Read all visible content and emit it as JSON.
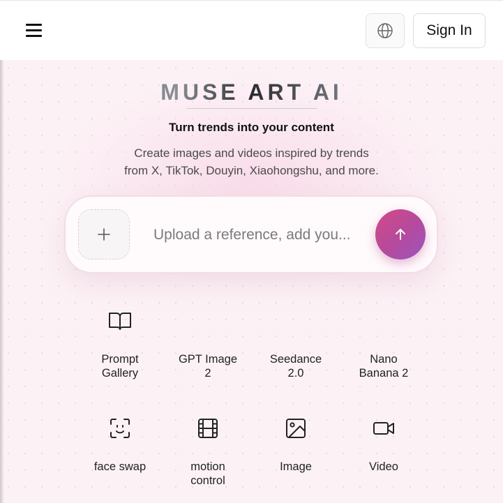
{
  "header": {
    "menu_icon": "hamburger-menu-icon",
    "language_icon": "globe-icon",
    "sign_in_label": "Sign In"
  },
  "hero": {
    "brand": "MUSE ART AI",
    "tagline": "Turn trends into your content",
    "description_line1": "Create images and videos inspired by trends",
    "description_line2": "from X, TikTok, Douyin, Xiaohongshu, and more."
  },
  "prompt": {
    "add_icon": "plus-icon",
    "placeholder": "Upload a reference, add you...",
    "send_icon": "arrow-up-icon",
    "send_color": "#c44a92"
  },
  "tools": [
    {
      "label_line1": "Prompt",
      "label_line2": "Gallery",
      "icon": "book-open-icon"
    },
    {
      "label_line1": "GPT Image",
      "label_line2": "2",
      "icon": ""
    },
    {
      "label_line1": "Seedance",
      "label_line2": "2.0",
      "icon": ""
    },
    {
      "label_line1": "Nano",
      "label_line2": "Banana 2",
      "icon": ""
    },
    {
      "label_line1": "face swap",
      "label_line2": "",
      "icon": "face-scan-icon"
    },
    {
      "label_line1": "motion",
      "label_line2": "control",
      "icon": "film-icon"
    },
    {
      "label_line1": "Image",
      "label_line2": "",
      "icon": "image-icon"
    },
    {
      "label_line1": "Video",
      "label_line2": "",
      "icon": "video-camera-icon"
    }
  ]
}
